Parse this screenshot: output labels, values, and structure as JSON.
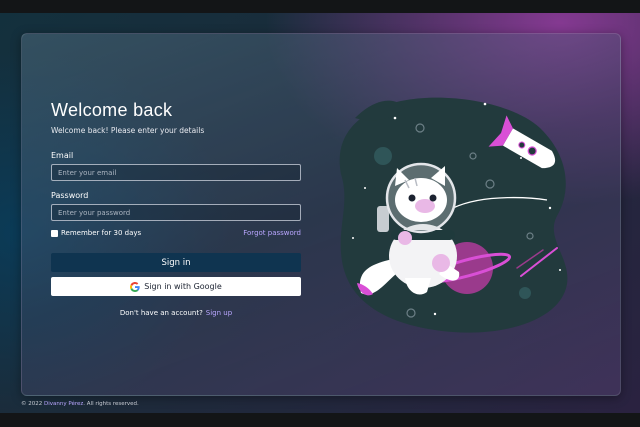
{
  "title": "Welcome back",
  "subtitle": "Welcome back! Please enter your details",
  "email": {
    "label": "Email",
    "placeholder": "Enter your email",
    "value": ""
  },
  "password": {
    "label": "Password",
    "placeholder": "Enter your password",
    "value": ""
  },
  "remember": {
    "label": "Remember for 30 days",
    "checked": false
  },
  "forgot_label": "Forgot password",
  "signin_label": "Sign in",
  "google_label": "Sign in with Google",
  "signup": {
    "prompt": "Don't have an account?",
    "link": "Sign up"
  },
  "footer": {
    "prefix": "© 2022",
    "author": "Divanny Pérez",
    "suffix": ". All rights reserved."
  },
  "colors": {
    "accent": "#b9a6ff",
    "primary_button": "#0f3450",
    "illustration_pink": "#d94fd6"
  },
  "icons": [
    "google-icon",
    "astronaut-cat-illustration",
    "rocket-icon",
    "planet-icon"
  ]
}
